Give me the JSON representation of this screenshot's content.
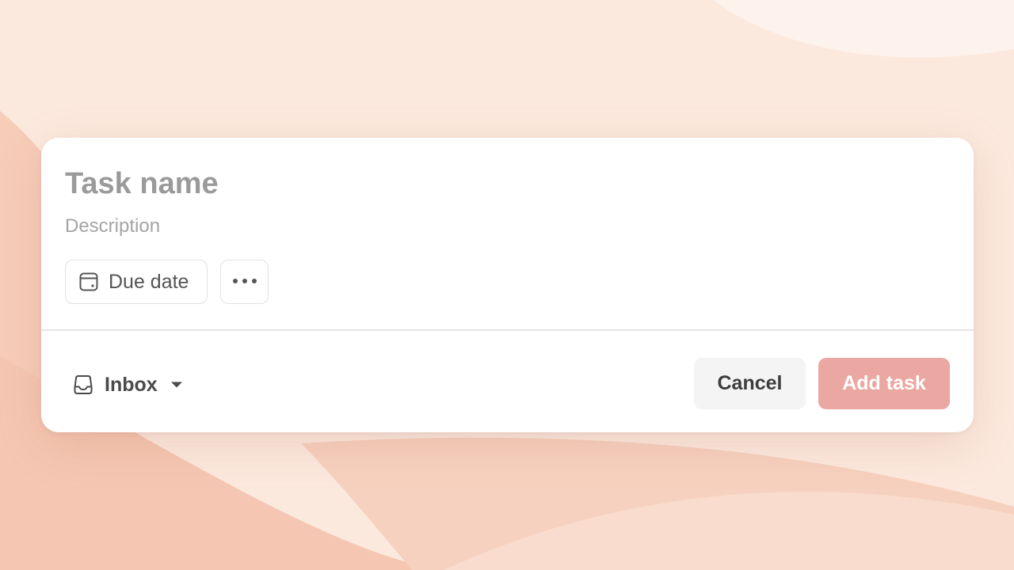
{
  "form": {
    "task_name_placeholder": "Task name",
    "task_name_value": "",
    "description_placeholder": "Description",
    "description_value": ""
  },
  "chips": {
    "due_date_label": "Due date",
    "due_date_icon": "calendar-icon",
    "more_icon": "more-horizontal-icon"
  },
  "footer": {
    "project_label": "Inbox",
    "project_icon": "inbox-icon",
    "project_caret_icon": "caret-down-icon",
    "cancel_label": "Cancel",
    "add_task_label": "Add task"
  },
  "colors": {
    "add_task_bg": "#eba7a1",
    "background": "#fbe7dc",
    "card_bg": "#ffffff"
  }
}
